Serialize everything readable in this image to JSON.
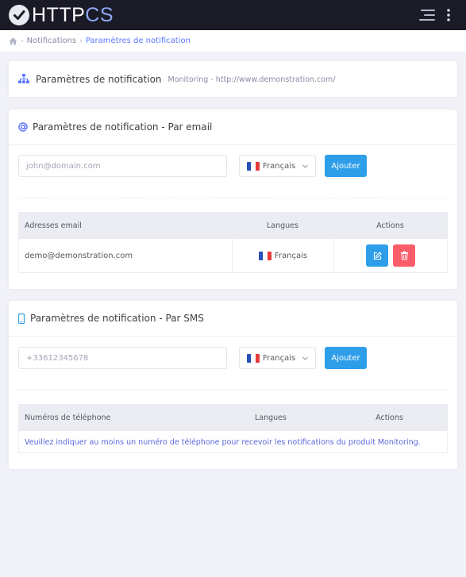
{
  "brand": {
    "part1": "HTTP",
    "part2": "CS"
  },
  "breadcrumb": {
    "items": [
      "Notifications",
      "Paramètres de notification"
    ]
  },
  "header_card": {
    "title": "Paramètres de notification",
    "subtitle": "Monitoring - http://www.demonstration.com/"
  },
  "email_section": {
    "title": "Paramètres de notification - Par email",
    "input_placeholder": "john@domain.com",
    "language_selected": "Français",
    "add_label": "Ajouter",
    "table": {
      "headers": [
        "Adresses email",
        "Langues",
        "Actions"
      ],
      "rows": [
        {
          "email": "demo@demonstration.com",
          "language": "Français"
        }
      ]
    }
  },
  "sms_section": {
    "title": "Paramètres de notification - Par SMS",
    "input_placeholder": "+33612345678",
    "language_selected": "Français",
    "add_label": "Ajouter",
    "table": {
      "headers": [
        "Numéros de téléphone",
        "Langues",
        "Actions"
      ],
      "empty_message": "Veuillez indiquer au moins un numéro de téléphone pour recevoir les notifications du produit Monitoring."
    }
  },
  "colors": {
    "topbar": "#1b1b28",
    "accent": "#5d78ff",
    "primary_button": "#2e9ee9",
    "edit_button": "#2e9ee9",
    "delete_button": "#fd5c6a",
    "brand_cs": "#8fa6f5"
  },
  "icons": {
    "logo": "check-circle-icon",
    "menu": "hamburger-menu-icon",
    "more": "vertical-dots-icon",
    "home": "home-icon",
    "sitemap": "sitemap-icon",
    "at": "at-sign-icon",
    "phone": "mobile-phone-icon",
    "edit": "edit-icon",
    "delete": "trash-icon",
    "flag": "french-flag-icon",
    "chevron": "chevron-down-icon"
  }
}
